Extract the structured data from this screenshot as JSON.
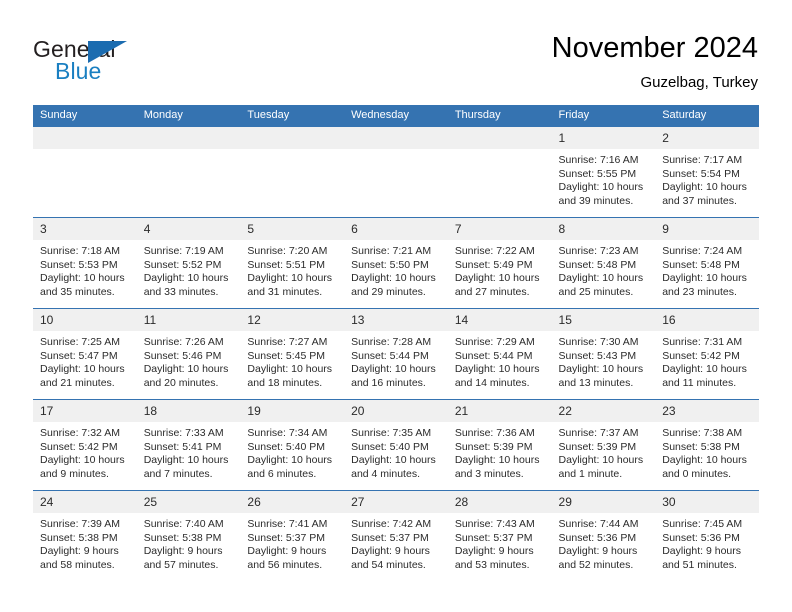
{
  "brand": {
    "word1": "General",
    "word2": "Blue",
    "flag_color": "#1b6cb0",
    "blue_text_color": "#1a7fc1"
  },
  "header": {
    "title": "November 2024",
    "subtitle": "Guzelbag, Turkey",
    "accent_color": "#3573b1",
    "daynum_band_color": "#f0f0f0"
  },
  "calendar": {
    "weekday_headers": [
      "Sunday",
      "Monday",
      "Tuesday",
      "Wednesday",
      "Thursday",
      "Friday",
      "Saturday"
    ],
    "weeks": [
      [
        {
          "day": "",
          "blank": true
        },
        {
          "day": "",
          "blank": true
        },
        {
          "day": "",
          "blank": true
        },
        {
          "day": "",
          "blank": true
        },
        {
          "day": "",
          "blank": true
        },
        {
          "day": "1",
          "sunrise": "Sunrise: 7:16 AM",
          "sunset": "Sunset: 5:55 PM",
          "daylight_1": "Daylight: 10 hours",
          "daylight_2": "and 39 minutes."
        },
        {
          "day": "2",
          "sunrise": "Sunrise: 7:17 AM",
          "sunset": "Sunset: 5:54 PM",
          "daylight_1": "Daylight: 10 hours",
          "daylight_2": "and 37 minutes."
        }
      ],
      [
        {
          "day": "3",
          "sunrise": "Sunrise: 7:18 AM",
          "sunset": "Sunset: 5:53 PM",
          "daylight_1": "Daylight: 10 hours",
          "daylight_2": "and 35 minutes."
        },
        {
          "day": "4",
          "sunrise": "Sunrise: 7:19 AM",
          "sunset": "Sunset: 5:52 PM",
          "daylight_1": "Daylight: 10 hours",
          "daylight_2": "and 33 minutes."
        },
        {
          "day": "5",
          "sunrise": "Sunrise: 7:20 AM",
          "sunset": "Sunset: 5:51 PM",
          "daylight_1": "Daylight: 10 hours",
          "daylight_2": "and 31 minutes."
        },
        {
          "day": "6",
          "sunrise": "Sunrise: 7:21 AM",
          "sunset": "Sunset: 5:50 PM",
          "daylight_1": "Daylight: 10 hours",
          "daylight_2": "and 29 minutes."
        },
        {
          "day": "7",
          "sunrise": "Sunrise: 7:22 AM",
          "sunset": "Sunset: 5:49 PM",
          "daylight_1": "Daylight: 10 hours",
          "daylight_2": "and 27 minutes."
        },
        {
          "day": "8",
          "sunrise": "Sunrise: 7:23 AM",
          "sunset": "Sunset: 5:48 PM",
          "daylight_1": "Daylight: 10 hours",
          "daylight_2": "and 25 minutes."
        },
        {
          "day": "9",
          "sunrise": "Sunrise: 7:24 AM",
          "sunset": "Sunset: 5:48 PM",
          "daylight_1": "Daylight: 10 hours",
          "daylight_2": "and 23 minutes."
        }
      ],
      [
        {
          "day": "10",
          "sunrise": "Sunrise: 7:25 AM",
          "sunset": "Sunset: 5:47 PM",
          "daylight_1": "Daylight: 10 hours",
          "daylight_2": "and 21 minutes."
        },
        {
          "day": "11",
          "sunrise": "Sunrise: 7:26 AM",
          "sunset": "Sunset: 5:46 PM",
          "daylight_1": "Daylight: 10 hours",
          "daylight_2": "and 20 minutes."
        },
        {
          "day": "12",
          "sunrise": "Sunrise: 7:27 AM",
          "sunset": "Sunset: 5:45 PM",
          "daylight_1": "Daylight: 10 hours",
          "daylight_2": "and 18 minutes."
        },
        {
          "day": "13",
          "sunrise": "Sunrise: 7:28 AM",
          "sunset": "Sunset: 5:44 PM",
          "daylight_1": "Daylight: 10 hours",
          "daylight_2": "and 16 minutes."
        },
        {
          "day": "14",
          "sunrise": "Sunrise: 7:29 AM",
          "sunset": "Sunset: 5:44 PM",
          "daylight_1": "Daylight: 10 hours",
          "daylight_2": "and 14 minutes."
        },
        {
          "day": "15",
          "sunrise": "Sunrise: 7:30 AM",
          "sunset": "Sunset: 5:43 PM",
          "daylight_1": "Daylight: 10 hours",
          "daylight_2": "and 13 minutes."
        },
        {
          "day": "16",
          "sunrise": "Sunrise: 7:31 AM",
          "sunset": "Sunset: 5:42 PM",
          "daylight_1": "Daylight: 10 hours",
          "daylight_2": "and 11 minutes."
        }
      ],
      [
        {
          "day": "17",
          "sunrise": "Sunrise: 7:32 AM",
          "sunset": "Sunset: 5:42 PM",
          "daylight_1": "Daylight: 10 hours",
          "daylight_2": "and 9 minutes."
        },
        {
          "day": "18",
          "sunrise": "Sunrise: 7:33 AM",
          "sunset": "Sunset: 5:41 PM",
          "daylight_1": "Daylight: 10 hours",
          "daylight_2": "and 7 minutes."
        },
        {
          "day": "19",
          "sunrise": "Sunrise: 7:34 AM",
          "sunset": "Sunset: 5:40 PM",
          "daylight_1": "Daylight: 10 hours",
          "daylight_2": "and 6 minutes."
        },
        {
          "day": "20",
          "sunrise": "Sunrise: 7:35 AM",
          "sunset": "Sunset: 5:40 PM",
          "daylight_1": "Daylight: 10 hours",
          "daylight_2": "and 4 minutes."
        },
        {
          "day": "21",
          "sunrise": "Sunrise: 7:36 AM",
          "sunset": "Sunset: 5:39 PM",
          "daylight_1": "Daylight: 10 hours",
          "daylight_2": "and 3 minutes."
        },
        {
          "day": "22",
          "sunrise": "Sunrise: 7:37 AM",
          "sunset": "Sunset: 5:39 PM",
          "daylight_1": "Daylight: 10 hours",
          "daylight_2": "and 1 minute."
        },
        {
          "day": "23",
          "sunrise": "Sunrise: 7:38 AM",
          "sunset": "Sunset: 5:38 PM",
          "daylight_1": "Daylight: 10 hours",
          "daylight_2": "and 0 minutes."
        }
      ],
      [
        {
          "day": "24",
          "sunrise": "Sunrise: 7:39 AM",
          "sunset": "Sunset: 5:38 PM",
          "daylight_1": "Daylight: 9 hours",
          "daylight_2": "and 58 minutes."
        },
        {
          "day": "25",
          "sunrise": "Sunrise: 7:40 AM",
          "sunset": "Sunset: 5:38 PM",
          "daylight_1": "Daylight: 9 hours",
          "daylight_2": "and 57 minutes."
        },
        {
          "day": "26",
          "sunrise": "Sunrise: 7:41 AM",
          "sunset": "Sunset: 5:37 PM",
          "daylight_1": "Daylight: 9 hours",
          "daylight_2": "and 56 minutes."
        },
        {
          "day": "27",
          "sunrise": "Sunrise: 7:42 AM",
          "sunset": "Sunset: 5:37 PM",
          "daylight_1": "Daylight: 9 hours",
          "daylight_2": "and 54 minutes."
        },
        {
          "day": "28",
          "sunrise": "Sunrise: 7:43 AM",
          "sunset": "Sunset: 5:37 PM",
          "daylight_1": "Daylight: 9 hours",
          "daylight_2": "and 53 minutes."
        },
        {
          "day": "29",
          "sunrise": "Sunrise: 7:44 AM",
          "sunset": "Sunset: 5:36 PM",
          "daylight_1": "Daylight: 9 hours",
          "daylight_2": "and 52 minutes."
        },
        {
          "day": "30",
          "sunrise": "Sunrise: 7:45 AM",
          "sunset": "Sunset: 5:36 PM",
          "daylight_1": "Daylight: 9 hours",
          "daylight_2": "and 51 minutes."
        }
      ]
    ]
  }
}
